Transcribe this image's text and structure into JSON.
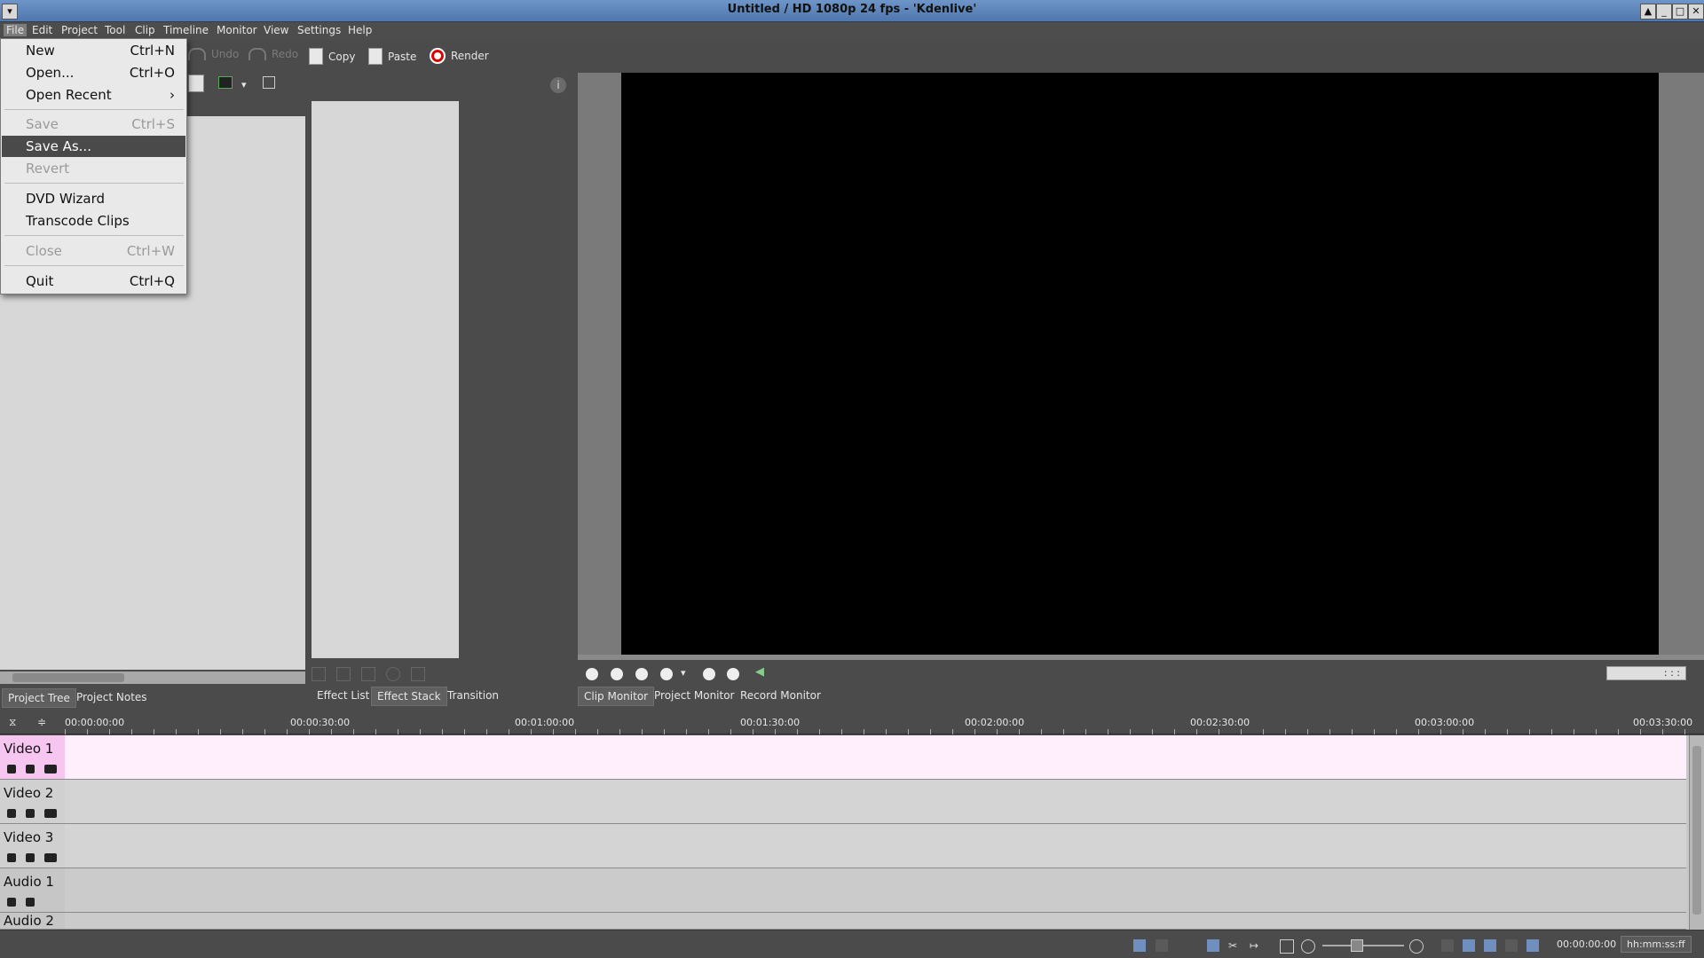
{
  "window": {
    "title": "Untitled / HD 1080p 24 fps - 'Kdenlive'",
    "controls": [
      "▲",
      "_",
      "□",
      "✕"
    ]
  },
  "menubar": [
    "File",
    "Edit",
    "Project",
    "Tool",
    "Clip",
    "Timeline",
    "Monitor",
    "View",
    "Settings",
    "Help"
  ],
  "toolbar": {
    "undo": "Undo",
    "redo": "Redo",
    "copy": "Copy",
    "paste": "Paste",
    "render": "Render"
  },
  "file_menu": {
    "items": [
      {
        "label": "New",
        "shortcut": "Ctrl+N",
        "enabled": true
      },
      {
        "label": "Open...",
        "shortcut": "Ctrl+O",
        "enabled": true
      },
      {
        "label": "Open Recent",
        "shortcut": "›",
        "enabled": true
      },
      {
        "label": "Save",
        "shortcut": "Ctrl+S",
        "enabled": false
      },
      {
        "label": "Save As...",
        "shortcut": "",
        "enabled": true,
        "highlighted": true
      },
      {
        "label": "Revert",
        "shortcut": "",
        "enabled": false
      },
      {
        "label": "DVD Wizard",
        "shortcut": "",
        "enabled": true
      },
      {
        "label": "Transcode Clips",
        "shortcut": "",
        "enabled": true
      },
      {
        "label": "Close",
        "shortcut": "Ctrl+W",
        "enabled": false
      },
      {
        "label": "Quit",
        "shortcut": "Ctrl+Q",
        "enabled": true
      }
    ]
  },
  "project_tabs": [
    "Project Tree",
    "Project Notes"
  ],
  "effect_tabs": [
    "Effect List",
    "Effect Stack",
    "Transition"
  ],
  "monitor_tabs": [
    "Clip Monitor",
    "Project Monitor",
    "Record Monitor"
  ],
  "monitor": {
    "timecode": ": : :"
  },
  "timeline": {
    "ruler_labels": [
      "00:00:00:00",
      "00:00:30:00",
      "00:01:00:00",
      "00:01:30:00",
      "00:02:00:00",
      "00:02:30:00",
      "00:03:00:00",
      "00:03:30:00"
    ],
    "tracks": [
      {
        "name": "Video 1",
        "selected": true
      },
      {
        "name": "Video 2",
        "selected": false
      },
      {
        "name": "Video 3",
        "selected": false
      },
      {
        "name": "Audio 1",
        "selected": false
      },
      {
        "name": "Audio 2",
        "selected": false
      }
    ],
    "selected_color": "#f7c6f0",
    "selected_body_color": "#ffeefb"
  },
  "statusbar": {
    "timecode": "00:00:00:00",
    "time_format": "hh:mm:ss:ff"
  }
}
